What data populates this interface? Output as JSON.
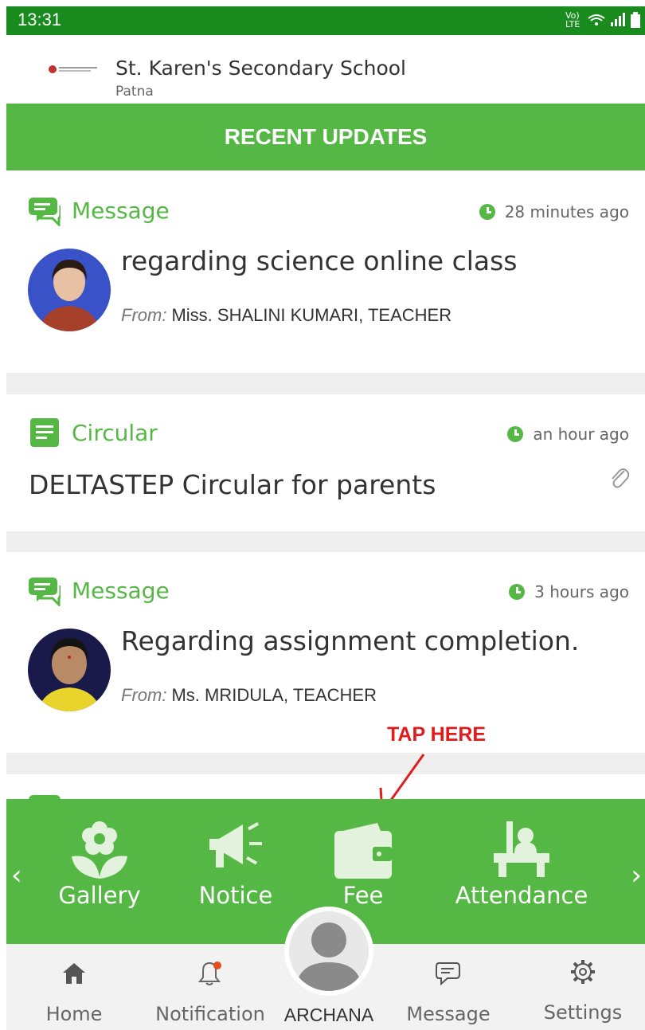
{
  "status_bar": {
    "time": "13:31",
    "network": "Vo) LTE"
  },
  "school": {
    "name": "St. Karen's Secondary School",
    "city": "Patna"
  },
  "section_title": "RECENT UPDATES",
  "colors": {
    "primary": "#55b844",
    "status": "#1a8b1e",
    "accent_red": "#e21b1b"
  },
  "updates": [
    {
      "type": "Message",
      "time": "28 minutes ago",
      "title": "regarding science online class",
      "from_label": "From:",
      "from": "Miss. SHALINI KUMARI, TEACHER",
      "icon": "chat-icon"
    },
    {
      "type": "Circular",
      "time": "an hour ago",
      "title": "DELTASTEP Circular for parents",
      "icon": "document-icon",
      "attachment": "paperclip-icon"
    },
    {
      "type": "Message",
      "time": "3 hours ago",
      "title": "Regarding assignment completion.",
      "from_label": "From:",
      "from": "Ms. MRIDULA, TEACHER",
      "icon": "chat-icon"
    }
  ],
  "annotation": {
    "text": "TAP HERE"
  },
  "quick_actions": [
    {
      "label": "Gallery",
      "icon": "flower-icon"
    },
    {
      "label": "Notice",
      "icon": "megaphone-icon"
    },
    {
      "label": "Fee",
      "icon": "wallet-icon"
    },
    {
      "label": "Attendance",
      "icon": "desk-icon"
    }
  ],
  "bottom_nav": {
    "home": "Home",
    "notification": "Notification",
    "profile_name": "ARCHANA",
    "message": "Message",
    "settings": "Settings"
  }
}
